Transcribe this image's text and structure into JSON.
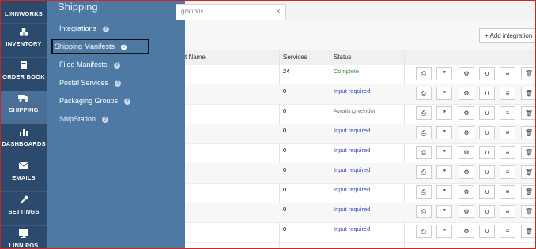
{
  "nav": [
    {
      "label": "LINNWORKS",
      "icon": "linnworks-logo"
    },
    {
      "label": "INVENTORY",
      "icon": "cubes-icon"
    },
    {
      "label": "ORDER BOOK",
      "icon": "book-icon"
    },
    {
      "label": "SHIPPING",
      "icon": "truck-icon"
    },
    {
      "label": "DASHBOARDS",
      "icon": "bar-chart-icon"
    },
    {
      "label": "EMAILS",
      "icon": "envelope-icon"
    },
    {
      "label": "SETTINGS",
      "icon": "wrench-icon"
    },
    {
      "label": "LINN POS",
      "icon": "monitor-icon"
    }
  ],
  "flyout": {
    "title": "Shipping",
    "items": [
      {
        "label": "Integrations"
      },
      {
        "label": "Shipping Manifests"
      },
      {
        "label": "Filed Manifests"
      },
      {
        "label": "Postal Services"
      },
      {
        "label": "Packaging Groups"
      },
      {
        "label": "ShipStation"
      }
    ]
  },
  "tab": {
    "label": "grations"
  },
  "toolbar": {
    "add_label": "+ Add integration"
  },
  "table": {
    "columns": [
      "t Name",
      "Services",
      "Status"
    ],
    "rows": [
      {
        "services": "24",
        "status": "Complete"
      },
      {
        "services": "0",
        "status": "Input required"
      },
      {
        "services": "0",
        "status": "Awaiting vendor"
      },
      {
        "services": "0",
        "status": "Input required"
      },
      {
        "services": "0",
        "status": "Input required"
      },
      {
        "services": "0",
        "status": "Input required"
      },
      {
        "services": "0",
        "status": "Input required"
      },
      {
        "services": "0",
        "status": "Input required"
      },
      {
        "services": "0",
        "status": "Input required"
      }
    ]
  },
  "colors": {
    "highlight_border": "#111111",
    "frame_border": "#c62828",
    "nav_bg": "#2c4a6c",
    "flyout_bg": "#4e79a5"
  }
}
